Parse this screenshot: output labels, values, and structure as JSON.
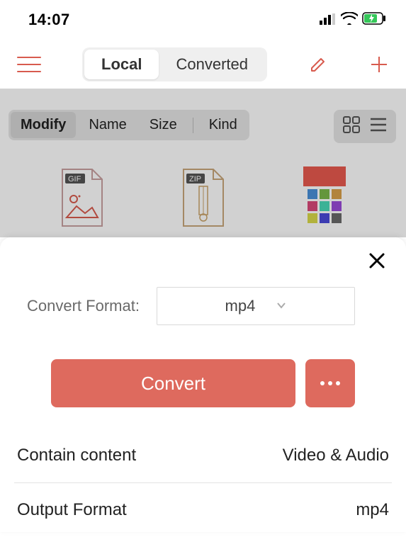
{
  "status": {
    "time": "14:07"
  },
  "tabs": {
    "local": "Local",
    "converted": "Converted"
  },
  "sort": {
    "modify": "Modify",
    "name": "Name",
    "size": "Size",
    "kind": "Kind"
  },
  "files": {
    "gif_badge": "GIF",
    "zip_badge": "ZIP"
  },
  "sheet": {
    "format_label": "Convert Format:",
    "format_value": "mp4",
    "convert_button": "Convert",
    "contain_label": "Contain content",
    "contain_value": "Video & Audio",
    "output_label": "Output Format",
    "output_value": "mp4"
  }
}
